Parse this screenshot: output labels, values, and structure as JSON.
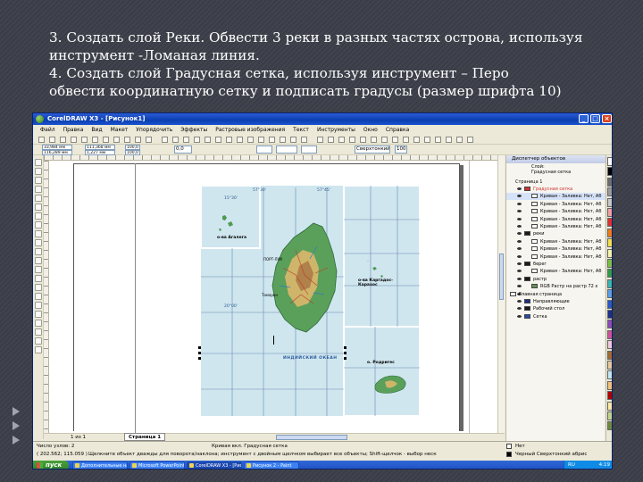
{
  "task": {
    "line1": "3. Создать слой Реки. Обвести 3 реки в разных частях острова, используя",
    "line2": "инструмент -Ломаная линия.",
    "line3": "4. Создать слой Градусная сетка, используя инструмент – Перо",
    "line4": "обвести координатную сетку и подписать градусы (размер шрифта 10)"
  },
  "window": {
    "title": "CorelDRAW X3 - [Рисунок1]",
    "minimize": "_",
    "maximize": "□",
    "close": "×"
  },
  "menu": [
    "Файл",
    "Правка",
    "Вид",
    "Макет",
    "Упорядочить",
    "Эффекты",
    "Растровые изображения",
    "Текст",
    "Инструменты",
    "Окно",
    "Справка"
  ],
  "toolbar": {
    "x": "33,984 мм",
    "y": "116,289 мм",
    "w": "111,368 мм",
    "h": "1,227 мм",
    "scale_x": "100,0",
    "scale_y": "100,0",
    "angle": "0,0",
    "outline": "Сверхтонкий",
    "zoom": "100"
  },
  "map": {
    "agalega": "о-ва Агалега",
    "cargados": "о-ва Каргадос-Карахос",
    "rodrigues": "о. Родригес",
    "ocean": "ИНДИЙСКИЙ ОКЕАН",
    "port_louis": "ПОРТ-ЛУИ",
    "tamarin": "Тамарин",
    "lat1": "15°30'",
    "lat2": "20°00'",
    "lon1": "57°30'",
    "lon2": "57°45'"
  },
  "docker": {
    "title": "Диспетчер объектов",
    "layer_label": "Слой:",
    "layer_name": "Градусная сетка",
    "page": "Страница 1",
    "rows": [
      {
        "text": "Градусная сетка",
        "indent": 30,
        "color": "#d12f2f",
        "red": true,
        "sel": false
      },
      {
        "text": "Кривая - Заливка: Нет, Аб",
        "indent": 38,
        "color": "#ffffff",
        "red": false,
        "sel": true
      },
      {
        "text": "Кривая - Заливка: Нет, Аб",
        "indent": 38,
        "color": "#ffffff",
        "red": false,
        "sel": false
      },
      {
        "text": "Кривая - Заливка: Нет, Аб",
        "indent": 38,
        "color": "#ffffff",
        "red": false,
        "sel": false
      },
      {
        "text": "Кривая - Заливка: Нет, Аб",
        "indent": 38,
        "color": "#ffffff",
        "red": false,
        "sel": false
      },
      {
        "text": "Кривая - Заливка: Нет, Аб",
        "indent": 38,
        "color": "#ffffff",
        "red": false,
        "sel": false
      },
      {
        "text": "реки",
        "indent": 30,
        "color": "#1a1a1a",
        "red": false,
        "sel": false
      },
      {
        "text": "Кривая - Заливка: Нет, Аб",
        "indent": 38,
        "color": "#ffffff",
        "red": false,
        "sel": false
      },
      {
        "text": "Кривая - Заливка: Нет, Аб",
        "indent": 38,
        "color": "#ffffff",
        "red": false,
        "sel": false
      },
      {
        "text": "Кривая - Заливка: Нет, Аб",
        "indent": 38,
        "color": "#ffffff",
        "red": false,
        "sel": false
      },
      {
        "text": "берег",
        "indent": 30,
        "color": "#1a1a1a",
        "red": false,
        "sel": false
      },
      {
        "text": "Кривая - Заливка: Нет, Аб",
        "indent": 38,
        "color": "#ffffff",
        "red": false,
        "sel": false
      },
      {
        "text": "растр",
        "indent": 30,
        "color": "#1a1a1a",
        "red": false,
        "sel": false
      },
      {
        "text": "RGB Растр на растр 72 x",
        "indent": 38,
        "color": "#6a8f5a",
        "red": false,
        "sel": false
      },
      {
        "text": "Главная страница",
        "indent": 14,
        "color": "#ffffff",
        "red": false,
        "sel": false
      },
      {
        "text": "Направляющие",
        "indent": 30,
        "color": "#1d2f8a",
        "red": false,
        "sel": false
      },
      {
        "text": "Рабочий стол",
        "indent": 30,
        "color": "#1a1a1a",
        "red": false,
        "sel": false
      },
      {
        "text": "Сетка",
        "indent": 30,
        "color": "#2a4aa8",
        "red": false,
        "sel": false
      }
    ]
  },
  "pager": {
    "count": "1 из 1",
    "tab": "Страница 1"
  },
  "status": {
    "nodes": "Число узлов: 2",
    "coords": "( 202.562; 115.059 )",
    "object": "Кривая вкл.  Градусная сетка",
    "hint": "Щелкните объект дважды для поворота/наклона; инструмент с двойным щелчком выбирает все объекты; Shift-щелчок - выбор нескол...",
    "fill": "Нет",
    "outline": "Черный  Сверхтонкий абрис"
  },
  "taskbar": {
    "start": "пуск",
    "items": [
      "Дополнительные на...",
      "Microsoft PowerPoint ...",
      "CorelDRAW X3 - [Рис...",
      "Рисунок 2 - Paint"
    ],
    "lang": "RU",
    "clock": "4:19"
  },
  "palette": [
    "#ffffff",
    "#000000",
    "#6c6c6c",
    "#9a9a9a",
    "#c8c8c8",
    "#f0a0a0",
    "#e03030",
    "#f07a1a",
    "#f6e04a",
    "#f8f3a8",
    "#7bc043",
    "#2e9e48",
    "#39b6b0",
    "#5aa0e8",
    "#2a58c8",
    "#1d2f8a",
    "#8e4ab8",
    "#d050a0",
    "#f4c8dc",
    "#a56a32",
    "#e8c89a",
    "#c4e6ee",
    "#f3c27a",
    "#b30000",
    "#ffe9a8",
    "#c2d48c",
    "#6e8a3a"
  ],
  "colors": {
    "accent": "#0a246a",
    "taskbar": "#245edb",
    "sea": "#cfe6ef"
  }
}
